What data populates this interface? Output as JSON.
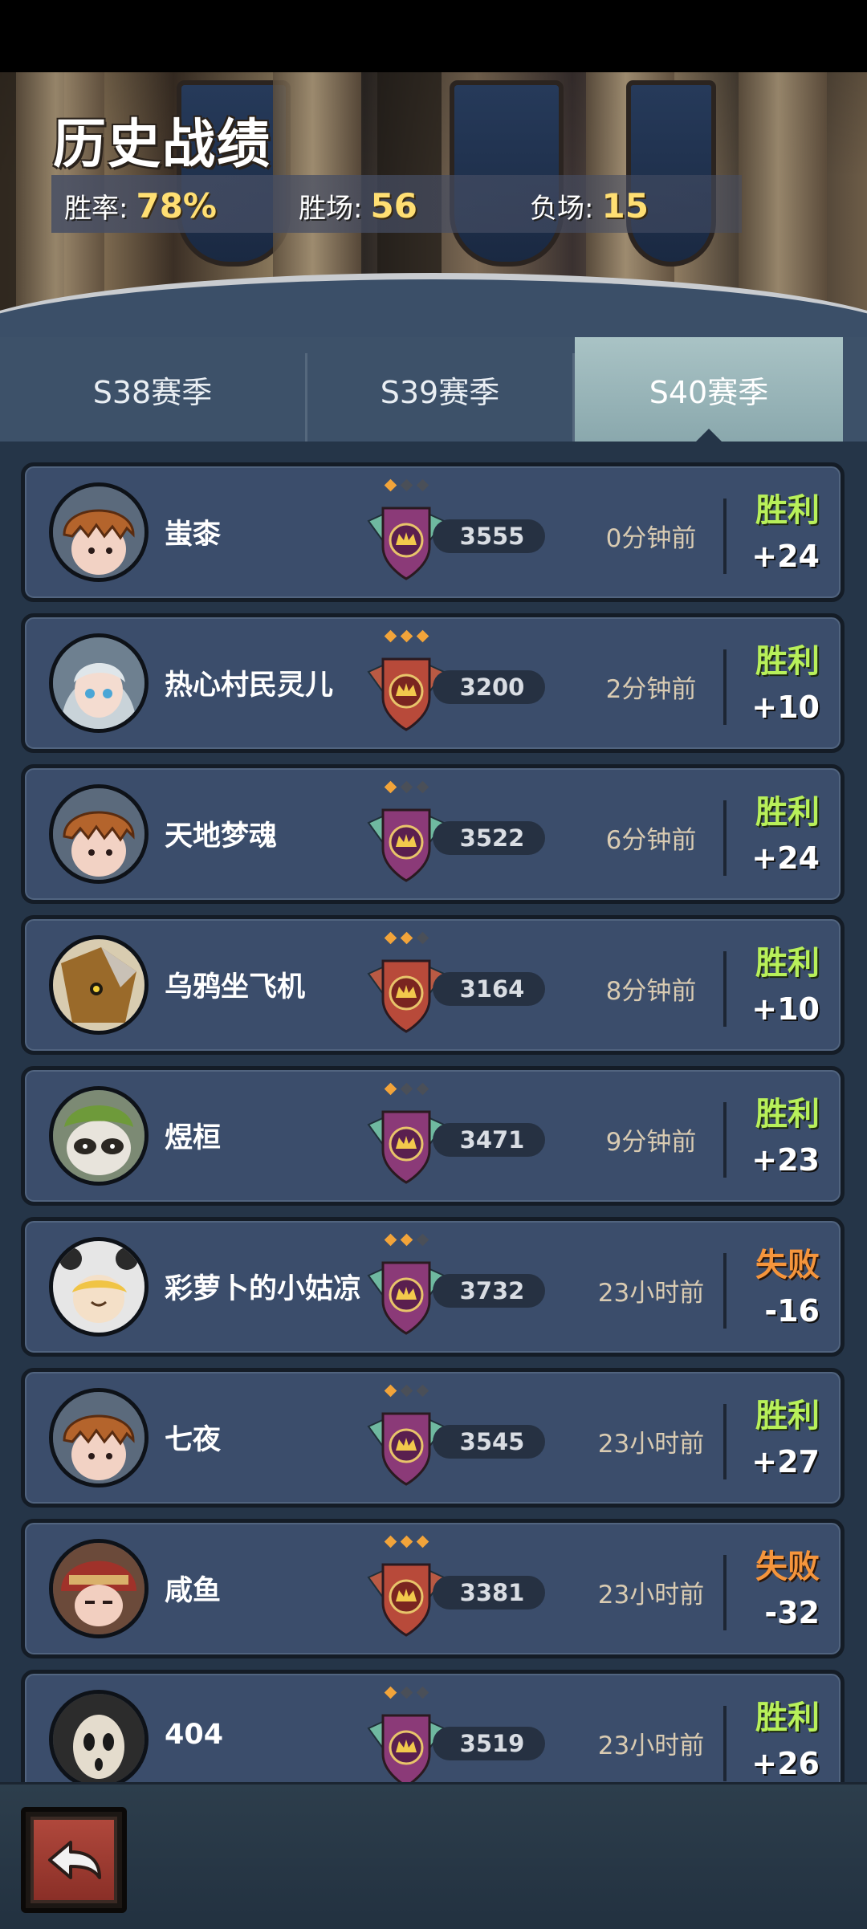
{
  "header": {
    "title": "历史战绩",
    "stats": [
      {
        "label": "胜率:",
        "value": "78%"
      },
      {
        "label": "胜场:",
        "value": "56"
      },
      {
        "label": "负场:",
        "value": "15"
      }
    ]
  },
  "tabs": [
    {
      "label": "S38赛季",
      "active": false
    },
    {
      "label": "S39赛季",
      "active": false
    },
    {
      "label": "S40赛季",
      "active": true
    }
  ],
  "matches": [
    {
      "name": "蚩桼",
      "rank": "3555",
      "time": "0分钟前",
      "result": "胜利",
      "delta": "+24",
      "outcome": "win",
      "badge": "green",
      "stars": 1,
      "avatar": "pumpkin"
    },
    {
      "name": "热心村民灵儿",
      "rank": "3200",
      "time": "2分钟前",
      "result": "胜利",
      "delta": "+10",
      "outcome": "win",
      "badge": "red",
      "stars": 3,
      "avatar": "silver-hair"
    },
    {
      "name": "天地梦魂",
      "rank": "3522",
      "time": "6分钟前",
      "result": "胜利",
      "delta": "+24",
      "outcome": "win",
      "badge": "green",
      "stars": 1,
      "avatar": "pumpkin"
    },
    {
      "name": "乌鸦坐飞机",
      "rank": "3164",
      "time": "8分钟前",
      "result": "胜利",
      "delta": "+10",
      "outcome": "win",
      "badge": "red",
      "stars": 2,
      "avatar": "scarecrow"
    },
    {
      "name": "煜桓",
      "rank": "3471",
      "time": "9分钟前",
      "result": "胜利",
      "delta": "+23",
      "outcome": "win",
      "badge": "green",
      "stars": 1,
      "avatar": "raccoon"
    },
    {
      "name": "彩萝卜的小姑凉",
      "rank": "3732",
      "time": "23小时前",
      "result": "失败",
      "delta": "-16",
      "outcome": "lose",
      "badge": "green",
      "stars": 2,
      "avatar": "panda-hood"
    },
    {
      "name": "七夜",
      "rank": "3545",
      "time": "23小时前",
      "result": "胜利",
      "delta": "+27",
      "outcome": "win",
      "badge": "green",
      "stars": 1,
      "avatar": "pumpkin"
    },
    {
      "name": "咸鱼",
      "rank": "3381",
      "time": "23小时前",
      "result": "失败",
      "delta": "-32",
      "outcome": "lose",
      "badge": "red",
      "stars": 3,
      "avatar": "red-helmet"
    },
    {
      "name": "404",
      "rank": "3519",
      "time": "23小时前",
      "result": "胜利",
      "delta": "+26",
      "outcome": "win",
      "badge": "green",
      "stars": 1,
      "avatar": "skull-mask"
    }
  ],
  "colors": {
    "win": "#b8f05a",
    "lose": "#f5953c",
    "stat_value": "#ffdf73",
    "row_bg": "#3b4d6b"
  },
  "icons": {
    "back": "back-arrow-icon"
  }
}
